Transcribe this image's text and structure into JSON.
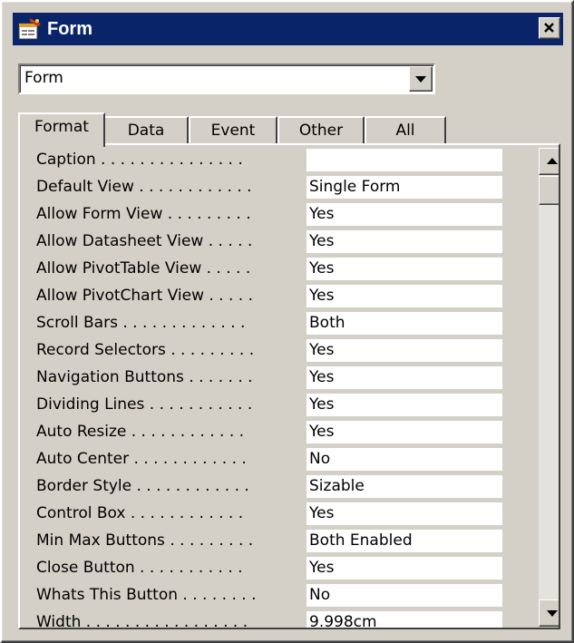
{
  "window": {
    "title": "Form",
    "icon": "form-properties-icon"
  },
  "selector": {
    "value": "Form",
    "icon": "chevron-down-icon"
  },
  "tabs": [
    {
      "label": "Format",
      "active": true
    },
    {
      "label": "Data",
      "active": false
    },
    {
      "label": "Event",
      "active": false
    },
    {
      "label": "Other",
      "active": false
    },
    {
      "label": "All",
      "active": false
    }
  ],
  "properties": [
    {
      "label": "Caption . . . . . . . . . . . . . . .",
      "value": ""
    },
    {
      "label": "Default View . . . . . . . . . . . .",
      "value": "Single Form"
    },
    {
      "label": "Allow Form View . . . . . . . . .",
      "value": "Yes"
    },
    {
      "label": "Allow Datasheet View . . . . .",
      "value": "Yes"
    },
    {
      "label": "Allow PivotTable View . . . . .",
      "value": "Yes"
    },
    {
      "label": "Allow PivotChart View . . . . .",
      "value": "Yes"
    },
    {
      "label": "Scroll Bars . . . . . . . . . . . . .",
      "value": "Both"
    },
    {
      "label": "Record Selectors . . . . . . . . .",
      "value": "Yes"
    },
    {
      "label": "Navigation Buttons . . . . . . .",
      "value": "Yes"
    },
    {
      "label": "Dividing Lines . . . . . . . . . . .",
      "value": "Yes"
    },
    {
      "label": "Auto Resize . . . . . . . . . . . .",
      "value": "Yes"
    },
    {
      "label": "Auto Center . . . . . . . . . . . .",
      "value": "No"
    },
    {
      "label": "Border Style . . . . . . . . . . . .",
      "value": "Sizable"
    },
    {
      "label": "Control Box . . . . . . . . . . . .",
      "value": "Yes"
    },
    {
      "label": "Min Max Buttons . . . . . . . . .",
      "value": "Both Enabled"
    },
    {
      "label": "Close Button . . . . . . . . . . .",
      "value": "Yes"
    },
    {
      "label": "Whats This Button . . . . . . . .",
      "value": "No"
    },
    {
      "label": "Width . . . . . . . . . . . . . . . . .",
      "value": "9.998cm"
    }
  ],
  "colors": {
    "titlebar": "#0a246a",
    "face": "#d4d0c8",
    "field": "#ffffff"
  }
}
